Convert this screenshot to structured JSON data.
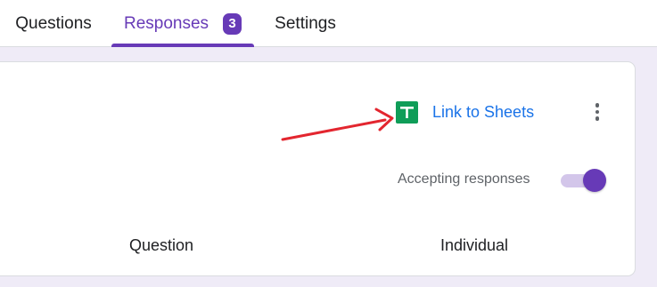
{
  "tabs": {
    "questions_label": "Questions",
    "responses_label": "Responses",
    "responses_count": "3",
    "settings_label": "Settings",
    "active": "Responses"
  },
  "card": {
    "link_to_sheets_label": "Link to Sheets",
    "accepting_responses_label": "Accepting responses",
    "accepting_responses_on": true,
    "summary_tabs": {
      "question_label": "Question",
      "individual_label": "Individual"
    }
  },
  "icons": {
    "sheets": "google-sheets-icon",
    "more": "more-vert-icon"
  },
  "colors": {
    "accent": "#673ab7",
    "link": "#1a73e8",
    "sheets_green": "#0f9d58",
    "annotation_arrow": "#e3262f",
    "page_background": "#efebf7"
  }
}
